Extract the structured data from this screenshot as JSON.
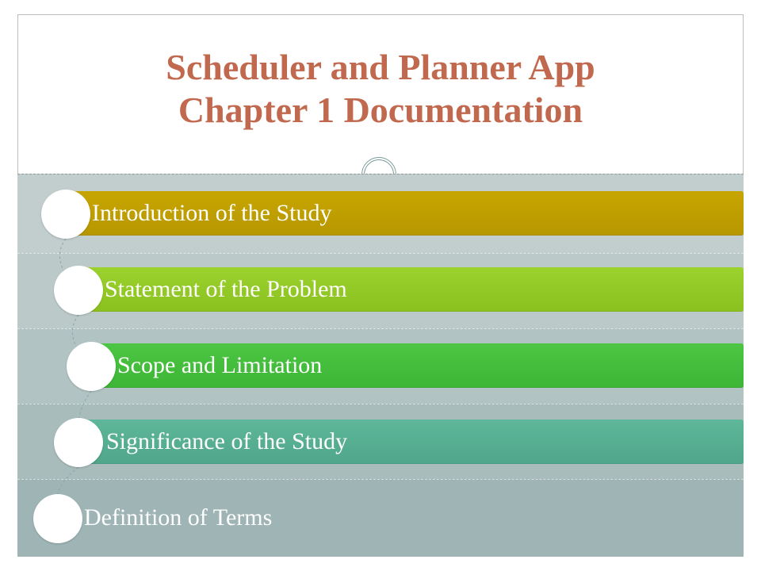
{
  "title_line1": "Scheduler and Planner App",
  "title_line2": "Chapter 1 Documentation",
  "items": [
    {
      "label": "Introduction of the Study"
    },
    {
      "label": "Statement of the Problem"
    },
    {
      "label": "Scope and Limitation"
    },
    {
      "label": "Significance of the Study"
    },
    {
      "label": "Definition of Terms"
    }
  ]
}
